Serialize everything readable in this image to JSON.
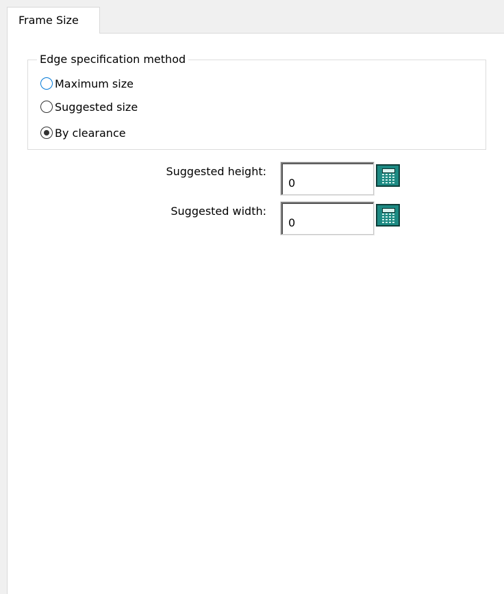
{
  "tabs": [
    {
      "label": "Frame Size",
      "active": true
    }
  ],
  "edge_group": {
    "title": "Edge specification method",
    "options": [
      {
        "label": "Maximum size",
        "selected": false
      },
      {
        "label": "Suggested size",
        "selected": false
      },
      {
        "label": "By clearance",
        "selected": true
      }
    ]
  },
  "fields": {
    "height": {
      "label": "Suggested height:",
      "value": "0"
    },
    "width": {
      "label": "Suggested width:",
      "value": "0"
    }
  },
  "icons": {
    "calculator": "calculator-icon"
  },
  "colors": {
    "calculator_button": "#1d8a83",
    "focus_ring": "#0078d7"
  }
}
